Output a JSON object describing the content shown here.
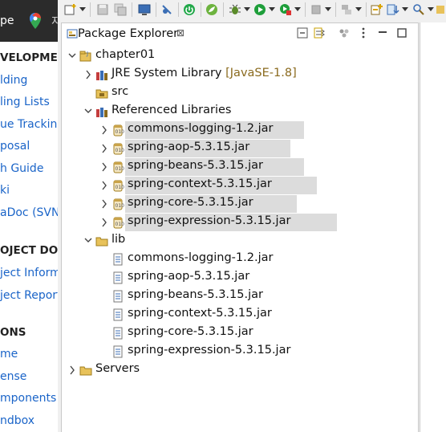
{
  "background_page": {
    "top_text": "pe",
    "top_text2": "지",
    "items": [
      {
        "label": "VELOPMENT",
        "kind": "head"
      },
      {
        "label": "lding",
        "kind": "link"
      },
      {
        "label": "ling Lists",
        "kind": "link"
      },
      {
        "label": "ue Tracking",
        "kind": "link"
      },
      {
        "label": "posal",
        "kind": "link"
      },
      {
        "label": "h Guide",
        "kind": "link"
      },
      {
        "label": "ki",
        "kind": "link"
      },
      {
        "label": "aDoc (SVN",
        "kind": "link"
      },
      {
        "label": "OJECT DOC",
        "kind": "head"
      },
      {
        "label": "ject Inform",
        "kind": "link"
      },
      {
        "label": "ject Report",
        "kind": "link"
      },
      {
        "label": "ONS",
        "kind": "head"
      },
      {
        "label": "me",
        "kind": "link"
      },
      {
        "label": "ense",
        "kind": "link"
      },
      {
        "label": "mponents",
        "kind": "link"
      },
      {
        "label": "ndbox",
        "kind": "link"
      }
    ]
  },
  "view": {
    "title": "Package Explorer",
    "close_glyph": "⊠"
  },
  "tree": [
    {
      "label": "chapter01",
      "twisty": "expanded",
      "icon": "project"
    },
    {
      "label": "JRE System Library",
      "decoration": "[JavaSE-1.8]",
      "twisty": "collapsed",
      "icon": "library"
    },
    {
      "label": "src",
      "twisty": "none",
      "icon": "source-folder"
    },
    {
      "label": "Referenced Libraries",
      "twisty": "expanded",
      "icon": "library"
    },
    {
      "label": "commons-logging-1.2.jar",
      "twisty": "collapsed",
      "icon": "jar",
      "highlight": true
    },
    {
      "label": "spring-aop-5.3.15.jar",
      "twisty": "collapsed",
      "icon": "jar",
      "highlight": true
    },
    {
      "label": "spring-beans-5.3.15.jar",
      "twisty": "collapsed",
      "icon": "jar",
      "highlight": true
    },
    {
      "label": "spring-context-5.3.15.jar",
      "twisty": "collapsed",
      "icon": "jar",
      "highlight": true
    },
    {
      "label": "spring-core-5.3.15.jar",
      "twisty": "collapsed",
      "icon": "jar",
      "highlight": true
    },
    {
      "label": "spring-expression-5.3.15.jar",
      "twisty": "collapsed",
      "icon": "jar",
      "highlight": true
    },
    {
      "label": "lib",
      "twisty": "expanded",
      "icon": "folder"
    },
    {
      "label": "commons-logging-1.2.jar",
      "twisty": "none",
      "icon": "file"
    },
    {
      "label": "spring-aop-5.3.15.jar",
      "twisty": "none",
      "icon": "file"
    },
    {
      "label": "spring-beans-5.3.15.jar",
      "twisty": "none",
      "icon": "file"
    },
    {
      "label": "spring-context-5.3.15.jar",
      "twisty": "none",
      "icon": "file"
    },
    {
      "label": "spring-core-5.3.15.jar",
      "twisty": "none",
      "icon": "file"
    },
    {
      "label": "spring-expression-5.3.15.jar",
      "twisty": "none",
      "icon": "file"
    },
    {
      "label": "Servers",
      "twisty": "collapsed",
      "icon": "folder"
    }
  ],
  "colors": {
    "highlight": "#dcdcdc",
    "decoration": "#8a6a1e",
    "link": "#1a64c8",
    "run_green": "#1e9e3a",
    "folder_yellow": "#e8c25a"
  }
}
